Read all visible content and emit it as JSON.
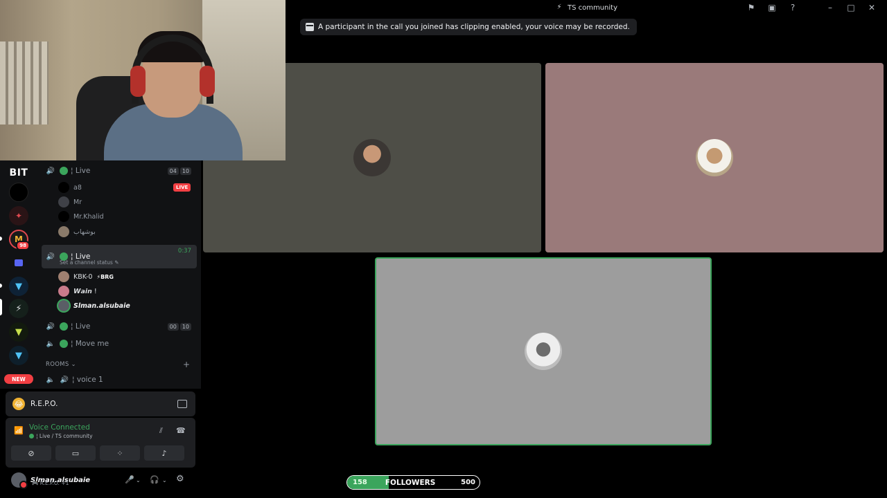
{
  "window": {
    "title": "TS community",
    "controls": [
      "flag-icon",
      "screen-icon",
      "help-icon",
      "minimize-icon",
      "maximize-icon",
      "close-icon"
    ]
  },
  "banner": {
    "text": "A participant in the call you joined has clipping enabled, your voice may be recorded."
  },
  "servers": {
    "logo": "BIT",
    "badge_count": "98",
    "new_label": "NEW"
  },
  "channels": {
    "live1": {
      "name": "¦ Live",
      "counts": [
        "04",
        "10"
      ]
    },
    "live1_users": [
      {
        "name": "a8",
        "live": "LIVE"
      },
      {
        "name": "Mr"
      },
      {
        "name": "Mr.Khalid"
      },
      {
        "name": "بوشهاب"
      }
    ],
    "live2": {
      "name": "¦ Live",
      "timer": "0:37",
      "status": "Set a channel status"
    },
    "live2_users": [
      {
        "name": "KBK-0",
        "tag": "⚡BRG"
      },
      {
        "name": "𝙒𝙖𝙞𝙣 !"
      },
      {
        "name": "Slman.alsubaie"
      }
    ],
    "live3": {
      "name": "¦ Live",
      "counts": [
        "00",
        "10"
      ]
    },
    "move": {
      "name": "¦ Move me"
    },
    "section": "ROOMS ⌄",
    "voice1": {
      "name": "¦ voice 1"
    }
  },
  "activity": {
    "name": "R.E.P.O."
  },
  "voice": {
    "status": "Voice Connected",
    "location": "¦ Live / TS community"
  },
  "user": {
    "name": "Slman.alsubaie",
    "sub": "🎮 R.E.P.O. +1"
  },
  "followers": {
    "current": "158",
    "label": "FOLLOWERS",
    "goal": "500",
    "progress": 0.316
  },
  "colors": {
    "accent_green": "#3ba55c",
    "danger_red": "#f23f43",
    "panel": "#1e1f22"
  }
}
